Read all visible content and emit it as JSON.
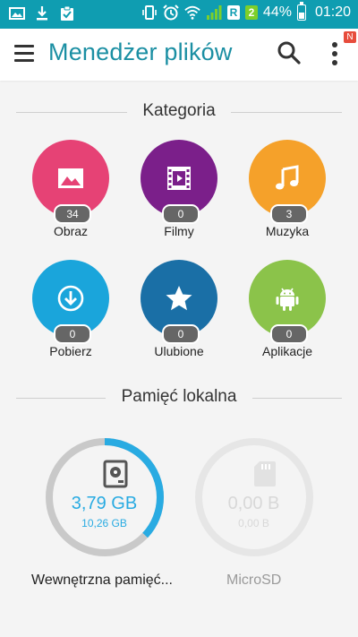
{
  "status_bar": {
    "battery": "44%",
    "time": "01:20",
    "sim1": "R",
    "sim2": "2"
  },
  "app_bar": {
    "title": "Menedżer plików",
    "notification_badge": "N"
  },
  "categories_section": {
    "title": "Kategoria",
    "items": [
      {
        "label": "Obraz",
        "count": "34",
        "color": "#e64275",
        "icon": "image-icon"
      },
      {
        "label": "Filmy",
        "count": "0",
        "color": "#7b1f8a",
        "icon": "film-icon"
      },
      {
        "label": "Muzyka",
        "count": "3",
        "color": "#f5a12a",
        "icon": "music-icon"
      },
      {
        "label": "Pobierz",
        "count": "0",
        "color": "#1aa5db",
        "icon": "download-icon"
      },
      {
        "label": "Ulubione",
        "count": "0",
        "color": "#1a6fa6",
        "icon": "star-icon"
      },
      {
        "label": "Aplikacje",
        "count": "0",
        "color": "#8bc34a",
        "icon": "android-icon"
      }
    ]
  },
  "storage_section": {
    "title": "Pamięć lokalna",
    "items": [
      {
        "name": "Wewnętrzna pamięć...",
        "used": "3,79 GB",
        "total": "10,26 GB",
        "used_fraction": 0.37
      },
      {
        "name": "MicroSD",
        "used": "0,00 B",
        "total": "0,00 B",
        "used_fraction": 0
      }
    ]
  },
  "colors": {
    "status_bar": "#0f9db1",
    "accent": "#1b8fa3",
    "ring_used": "#29abe2",
    "ring_track": "#c9c9c9"
  }
}
